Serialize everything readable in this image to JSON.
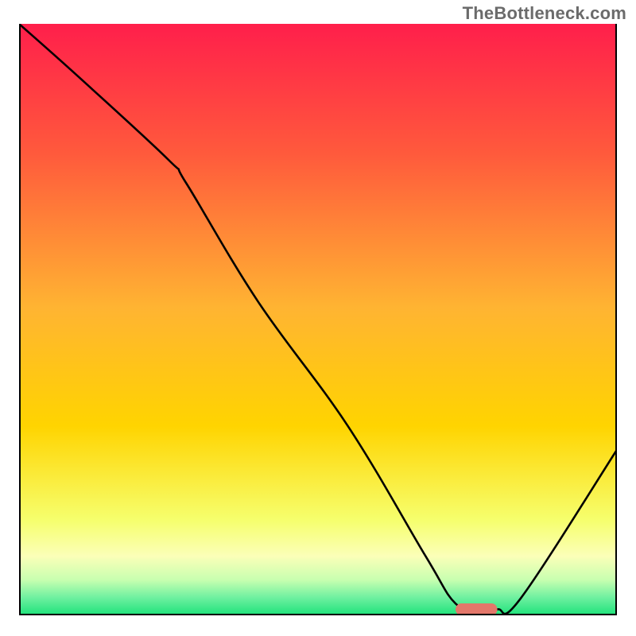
{
  "watermark": "TheBottleneck.com",
  "colors": {
    "top": "#ff1f4b",
    "mid": "#ffd400",
    "lightYellow": "#fbffb8",
    "green": "#1de27a",
    "curve": "#000000",
    "border": "#000000",
    "marker": "#e3776a"
  },
  "chart_data": {
    "type": "line",
    "title": "",
    "xlabel": "",
    "ylabel": "",
    "xlim": [
      0,
      100
    ],
    "ylim": [
      0,
      100
    ],
    "series": [
      {
        "name": "bottleneck-curve",
        "x": [
          0,
          10,
          25,
          28,
          40,
          55,
          68,
          73,
          77,
          80,
          84,
          100
        ],
        "values": [
          100,
          91,
          77,
          73,
          53,
          32,
          10,
          2,
          1,
          1,
          3,
          28
        ]
      }
    ],
    "marker": {
      "x0": 73,
      "x1": 80,
      "y": 1
    },
    "gradient_stops": [
      {
        "offset": 0.0,
        "y": 100
      },
      {
        "offset": 0.5,
        "y": 50
      },
      {
        "offset": 0.82,
        "y": 18
      },
      {
        "offset": 0.92,
        "y": 8
      },
      {
        "offset": 0.96,
        "y": 4
      },
      {
        "offset": 1.0,
        "y": 0
      }
    ]
  }
}
